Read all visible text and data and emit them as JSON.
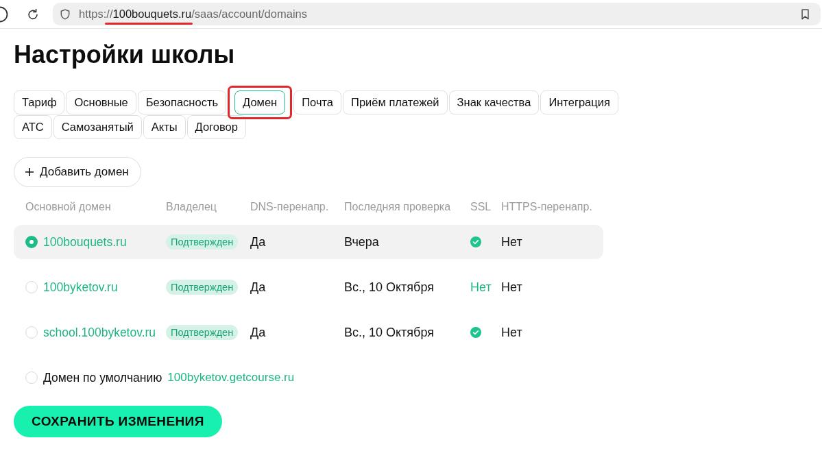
{
  "address_bar": {
    "scheme": "https://",
    "host": "100bouquets.ru",
    "path": "/saas/account/domains",
    "host_underlined": true
  },
  "page": {
    "title": "Настройки школы"
  },
  "tabs": [
    {
      "label": "Тариф",
      "selected": false,
      "highlighted": false
    },
    {
      "label": "Основные",
      "selected": false,
      "highlighted": false
    },
    {
      "label": "Безопасность",
      "selected": false,
      "highlighted": false
    },
    {
      "label": "Домен",
      "selected": true,
      "highlighted": true
    },
    {
      "label": "Почта",
      "selected": false,
      "highlighted": false
    },
    {
      "label": "Приём платежей",
      "selected": false,
      "highlighted": false
    },
    {
      "label": "Знак качества",
      "selected": false,
      "highlighted": false
    },
    {
      "label": "Интеграция",
      "selected": false,
      "highlighted": false
    },
    {
      "label": "АТС",
      "selected": false,
      "highlighted": false
    },
    {
      "label": "Самозанятый",
      "selected": false,
      "highlighted": false
    },
    {
      "label": "Акты",
      "selected": false,
      "highlighted": false
    },
    {
      "label": "Договор",
      "selected": false,
      "highlighted": false
    }
  ],
  "add_button": {
    "label": "Добавить домен"
  },
  "table": {
    "columns": [
      "Основной домен",
      "Владелец",
      "DNS-перенапр.",
      "Последняя проверка",
      "SSL",
      "HTTPS-перенапр."
    ],
    "rows": [
      {
        "selected": true,
        "domain": "100bouquets.ru",
        "owner": "Подтвержден",
        "dns": "Да",
        "last_check": "Вчера",
        "ssl": {
          "kind": "check"
        },
        "https": "Нет"
      },
      {
        "selected": false,
        "domain": "100byketov.ru",
        "owner": "Подтвержден",
        "dns": "Да",
        "last_check": "Вс., 10 Октября",
        "ssl": {
          "kind": "text",
          "text": "Нет"
        },
        "https": "Нет"
      },
      {
        "selected": false,
        "domain": "school.100byketov.ru",
        "owner": "Подтвержден",
        "dns": "Да",
        "last_check": "Вс., 10 Октября",
        "ssl": {
          "kind": "check"
        },
        "https": "Нет"
      }
    ]
  },
  "default_domain": {
    "selected": false,
    "label": "Домен по умолчанию",
    "domain": "100byketov.getcourse.ru"
  },
  "save_button": {
    "label": "СОХРАНИТЬ ИЗМЕНЕНИЯ"
  }
}
